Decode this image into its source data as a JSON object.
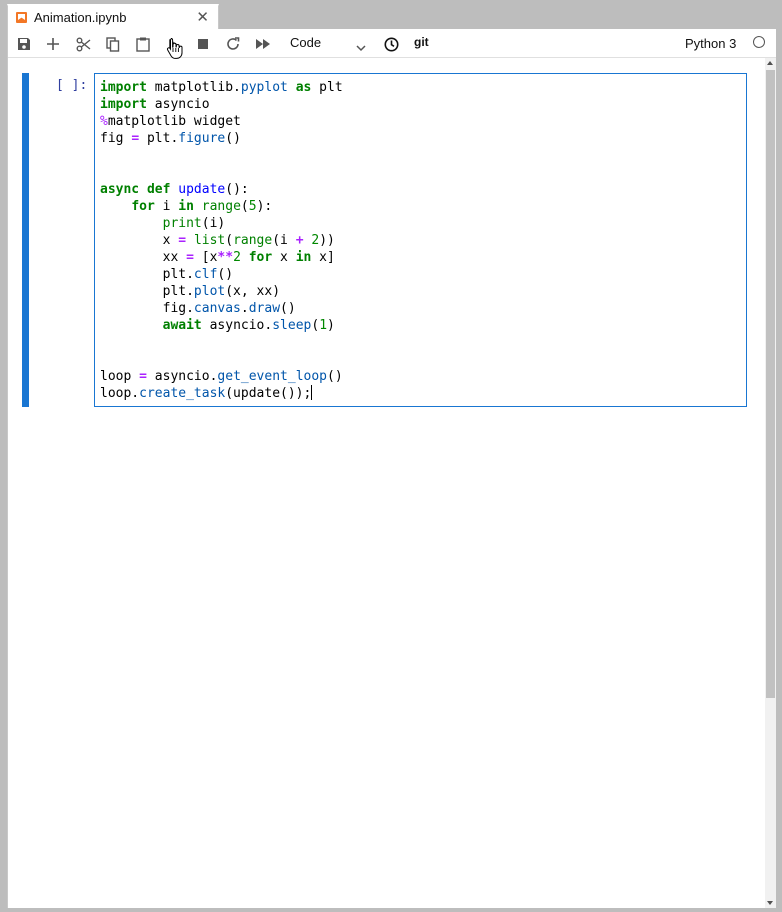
{
  "tab": {
    "title": "Animation.ipynb",
    "close": "✕"
  },
  "toolbar": {
    "cell_type": "Code",
    "git_label": "git",
    "kernel_name": "Python 3"
  },
  "cell": {
    "prompt": "[ ]:",
    "code_lines": [
      "import matplotlib.pyplot as plt",
      "import asyncio",
      "%matplotlib widget",
      "fig = plt.figure()",
      "",
      "",
      "async def update():",
      "    for i in range(5):",
      "        print(i)",
      "        x = list(range(i + 2))",
      "        xx = [x**2 for x in x]",
      "        plt.clf()",
      "        plt.plot(x, xx)",
      "        fig.canvas.draw()",
      "        await asyncio.sleep(1)",
      "",
      "",
      "loop = asyncio.get_event_loop()",
      "loop.create_task(update());"
    ]
  },
  "colors": {
    "accent": "#1976d2",
    "keyword": "#008000",
    "operator": "#aa22ff",
    "attribute": "#0055aa",
    "prompt": "#303f9f"
  }
}
